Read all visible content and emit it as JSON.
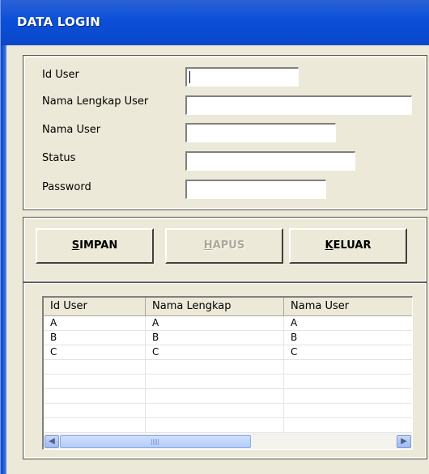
{
  "window": {
    "title": "DATA LOGIN"
  },
  "form": {
    "fields": [
      {
        "label": "Id User",
        "value": ""
      },
      {
        "label": "Nama Lengkap User",
        "value": ""
      },
      {
        "label": "Nama User",
        "value": ""
      },
      {
        "label": "Status",
        "value": ""
      },
      {
        "label": "Password",
        "value": ""
      }
    ]
  },
  "buttons": {
    "simpan": {
      "mnemonic": "S",
      "rest": "IMPAN",
      "enabled": true
    },
    "hapus": {
      "mnemonic": "H",
      "rest": "APUS",
      "enabled": false
    },
    "keluar": {
      "mnemonic": "K",
      "rest": "ELUAR",
      "enabled": true
    }
  },
  "grid": {
    "columns": [
      "Id User",
      "Nama Lengkap",
      "Nama User"
    ],
    "rows": [
      [
        "A",
        "A",
        "A"
      ],
      [
        "B",
        "B",
        "B"
      ],
      [
        "C",
        "C",
        "C"
      ]
    ]
  },
  "icons": {
    "scroll_left": "scroll-left-arrow",
    "scroll_right": "scroll-right-arrow"
  },
  "colors": {
    "title_bar": "#0b4fd8",
    "window_bg": "#ece9d8"
  }
}
